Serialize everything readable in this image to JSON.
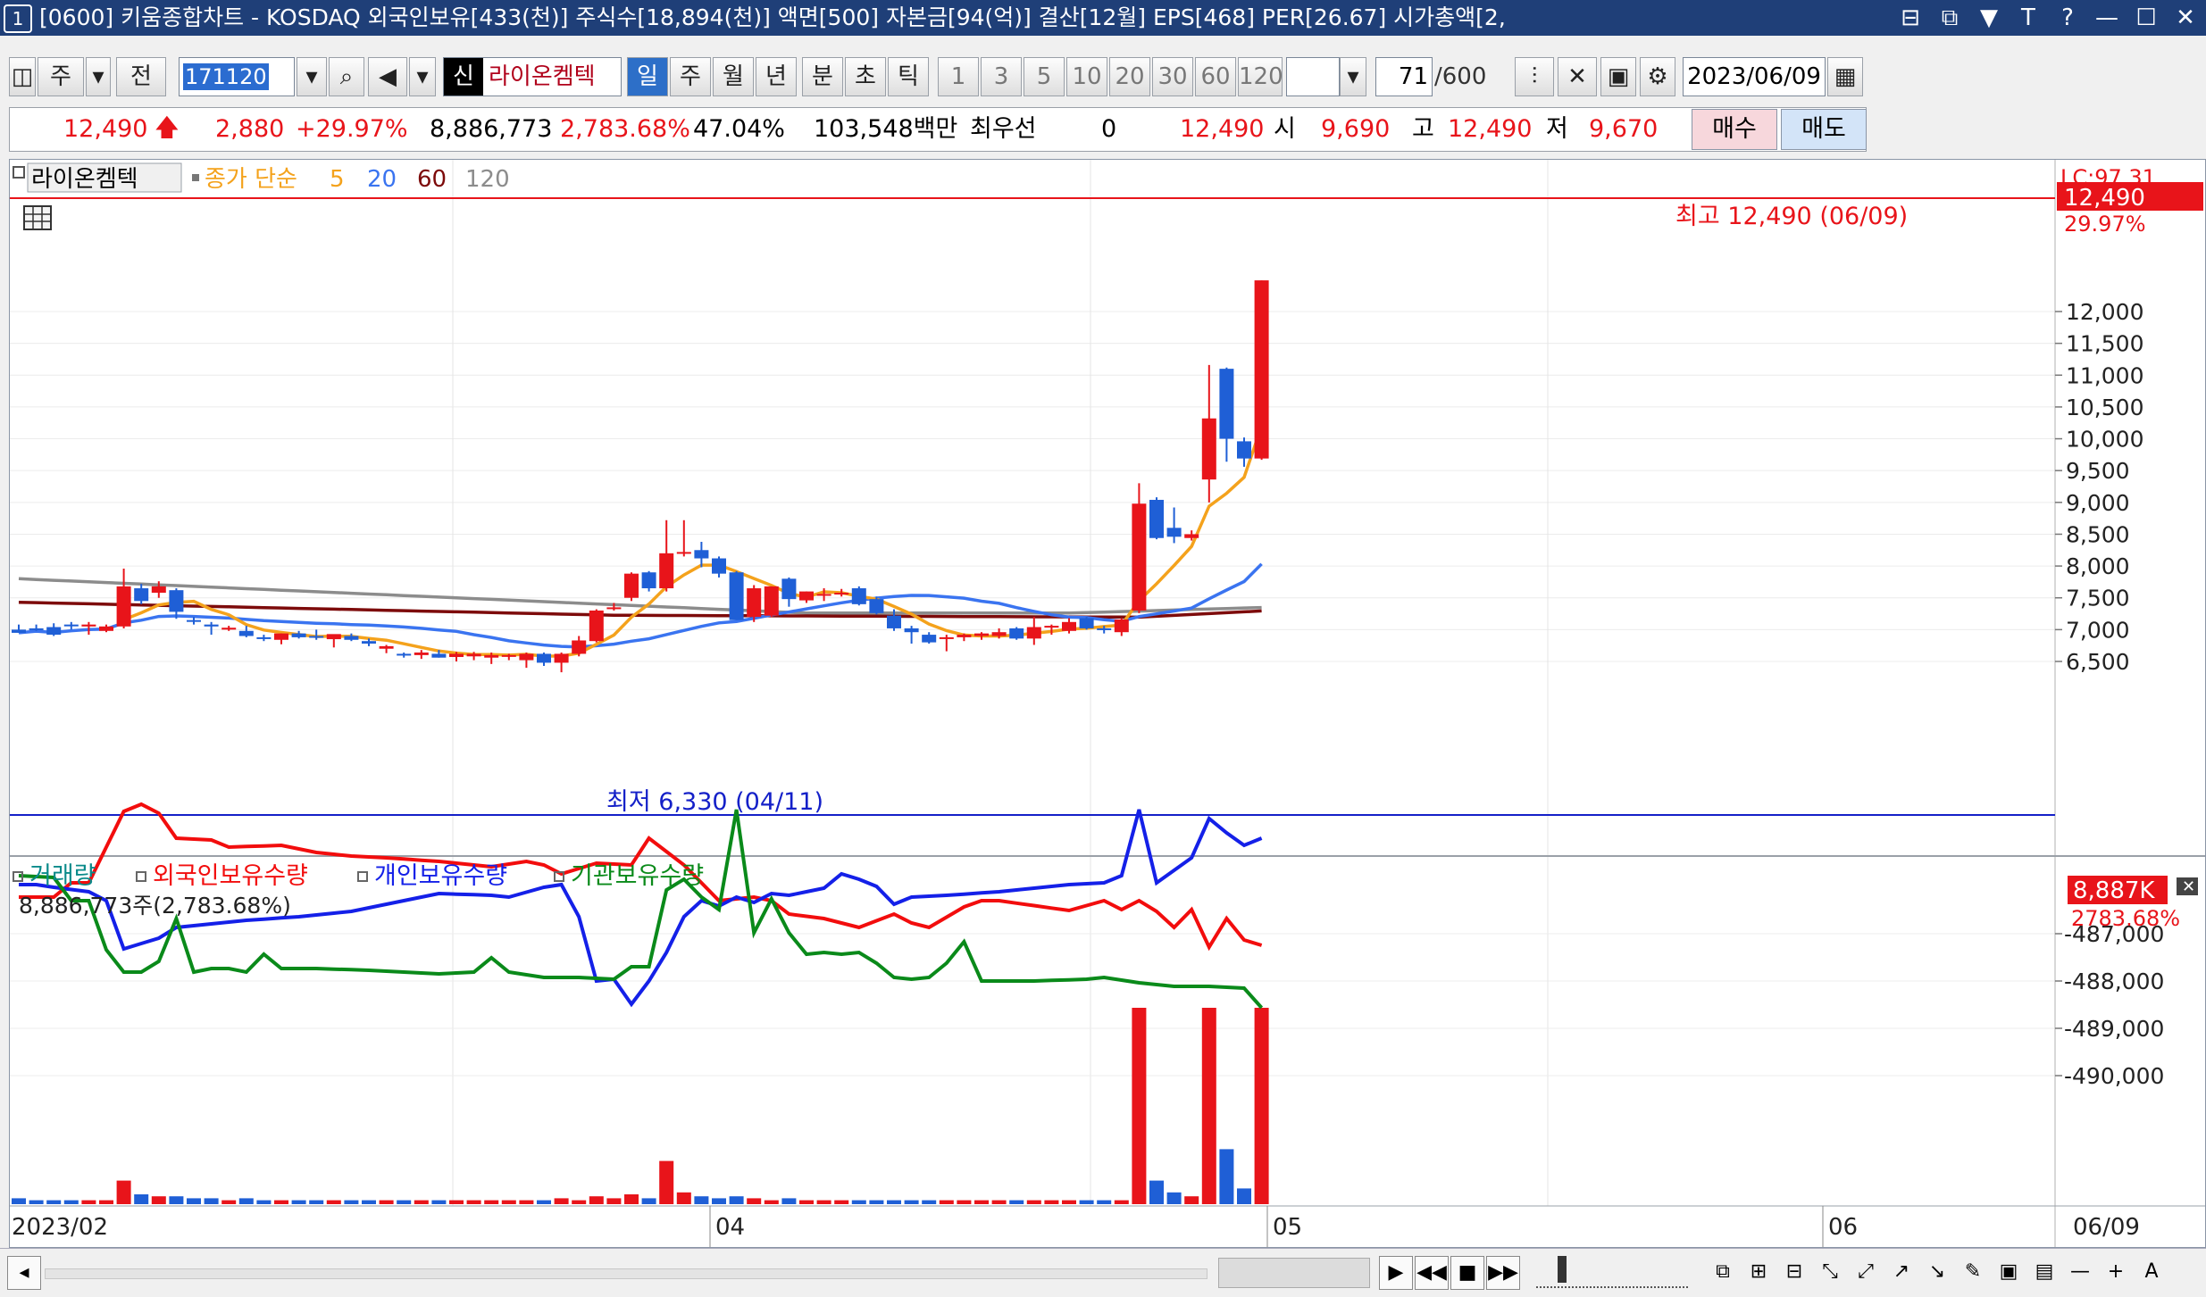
{
  "window": {
    "num": "1",
    "title": "[0600] 키움종합차트 - KOSDAQ 외국인보유[433(천)] 주식수[18,894(천)] 액면[500] 자본금[94(억)] 결산[12월] EPS[468] PER[26.67] 시가총액[2,",
    "controls": [
      "⊟",
      "⧉",
      "▼",
      "T",
      "?",
      "—",
      "☐",
      "✕"
    ]
  },
  "toolbar": {
    "market": "주",
    "mode": "전",
    "code": "171120",
    "shin": "신",
    "stock_name": "라이온켐텍",
    "periods": [
      "일",
      "주",
      "월",
      "년",
      "분",
      "초",
      "틱"
    ],
    "selected_period": "일",
    "intervals": [
      "1",
      "3",
      "5",
      "10",
      "20",
      "30",
      "60",
      "120"
    ],
    "count": "71",
    "count_total": "/600",
    "date": "2023/06/09"
  },
  "quote": {
    "price": "12,490",
    "change": "2,880",
    "change_pct": "+29.97%",
    "volume": "8,886,773",
    "volume_pct": "2,783.68%",
    "ratio": "47.04%",
    "amount": "103,548백만",
    "best_label": "최우선",
    "best_qty": "0",
    "best_price": "12,490",
    "open_label": "시",
    "open": "9,690",
    "high_label": "고",
    "high": "12,490",
    "low_label": "저",
    "low": "9,670",
    "buy": "매수",
    "sell": "매도"
  },
  "colors": {
    "up": "#e8141a",
    "down": "#1f5fd6",
    "ma5": "#f4a21c",
    "ma20": "#3a74f0",
    "ma60": "#7d0b0b",
    "ma120": "#8c8c8c",
    "foreign": "#f20d0d",
    "individual": "#1420e8",
    "institution": "#0a8a1a"
  },
  "legend": {
    "name": "라이온켐텍",
    "ma_label": "종가 단순",
    "ma": [
      "5",
      "20",
      "60",
      "120"
    ]
  },
  "annotations": {
    "high": "최고 12,490 (06/09)",
    "low": "최저 6,330 (04/11)",
    "price_tag": "12,490",
    "pct_tag": "29.97%",
    "lc_tag": "LC:97.31"
  },
  "price_axis": [
    "12,000",
    "11,500",
    "11,000",
    "10,500",
    "10,000",
    "9,500",
    "9,000",
    "8,500",
    "8,000",
    "7,500",
    "7,000",
    "6,500"
  ],
  "lower": {
    "legend": [
      "거래량",
      "외국인보유수량",
      "개인보유수량",
      "기관보유수량"
    ],
    "info": "8,886,773주(2,783.68%)",
    "tag": "8,887K",
    "tag_pct": "2783.68%",
    "axis": [
      "-487,000",
      "-488,000",
      "-489,000",
      "-490,000"
    ]
  },
  "time_axis": [
    "2023/02",
    "04",
    "05",
    "06",
    "06/09"
  ],
  "chart_data": {
    "type": "candlestick",
    "title": "라이온켐텍",
    "ylim": [
      6200,
      12600
    ],
    "candles": [
      {
        "o": 7000,
        "h": 7080,
        "l": 6950,
        "c": 6950
      },
      {
        "o": 7020,
        "h": 7080,
        "l": 6980,
        "c": 7000
      },
      {
        "o": 7040,
        "h": 7100,
        "l": 6900,
        "c": 6920
      },
      {
        "o": 7080,
        "h": 7120,
        "l": 7000,
        "c": 7060
      },
      {
        "o": 7050,
        "h": 7120,
        "l": 6920,
        "c": 7080
      },
      {
        "o": 6980,
        "h": 7080,
        "l": 6960,
        "c": 7050
      },
      {
        "o": 7050,
        "h": 7960,
        "l": 7020,
        "c": 7680
      },
      {
        "o": 7650,
        "h": 7720,
        "l": 7400,
        "c": 7450
      },
      {
        "o": 7580,
        "h": 7760,
        "l": 7500,
        "c": 7680
      },
      {
        "o": 7620,
        "h": 7650,
        "l": 7170,
        "c": 7280
      },
      {
        "o": 7150,
        "h": 7200,
        "l": 7080,
        "c": 7130
      },
      {
        "o": 7080,
        "h": 7120,
        "l": 6920,
        "c": 7050
      },
      {
        "o": 7000,
        "h": 7060,
        "l": 6980,
        "c": 7030
      },
      {
        "o": 6980,
        "h": 7060,
        "l": 6880,
        "c": 6900
      },
      {
        "o": 6880,
        "h": 6920,
        "l": 6820,
        "c": 6860
      },
      {
        "o": 6840,
        "h": 6940,
        "l": 6770,
        "c": 6940
      },
      {
        "o": 6940,
        "h": 6980,
        "l": 6860,
        "c": 6880
      },
      {
        "o": 6900,
        "h": 7000,
        "l": 6840,
        "c": 6880
      },
      {
        "o": 6850,
        "h": 6920,
        "l": 6720,
        "c": 6930
      },
      {
        "o": 6900,
        "h": 6940,
        "l": 6820,
        "c": 6840
      },
      {
        "o": 6820,
        "h": 6860,
        "l": 6740,
        "c": 6780
      },
      {
        "o": 6700,
        "h": 6760,
        "l": 6630,
        "c": 6740
      },
      {
        "o": 6620,
        "h": 6640,
        "l": 6560,
        "c": 6600
      },
      {
        "o": 6600,
        "h": 6680,
        "l": 6540,
        "c": 6640
      },
      {
        "o": 6620,
        "h": 6680,
        "l": 6560,
        "c": 6560
      },
      {
        "o": 6570,
        "h": 6650,
        "l": 6500,
        "c": 6620
      },
      {
        "o": 6580,
        "h": 6650,
        "l": 6520,
        "c": 6620
      },
      {
        "o": 6560,
        "h": 6640,
        "l": 6460,
        "c": 6600
      },
      {
        "o": 6580,
        "h": 6620,
        "l": 6520,
        "c": 6600
      },
      {
        "o": 6520,
        "h": 6640,
        "l": 6400,
        "c": 6620
      },
      {
        "o": 6620,
        "h": 6640,
        "l": 6430,
        "c": 6480
      },
      {
        "o": 6480,
        "h": 6640,
        "l": 6330,
        "c": 6620
      },
      {
        "o": 6620,
        "h": 6900,
        "l": 6580,
        "c": 6830
      },
      {
        "o": 6820,
        "h": 7320,
        "l": 6800,
        "c": 7300
      },
      {
        "o": 7340,
        "h": 7420,
        "l": 7300,
        "c": 7350
      },
      {
        "o": 7500,
        "h": 7900,
        "l": 7450,
        "c": 7880
      },
      {
        "o": 7900,
        "h": 7920,
        "l": 7600,
        "c": 7650
      },
      {
        "o": 7650,
        "h": 8720,
        "l": 7600,
        "c": 8200
      },
      {
        "o": 8200,
        "h": 8720,
        "l": 8150,
        "c": 8220
      },
      {
        "o": 8250,
        "h": 8380,
        "l": 7980,
        "c": 8120
      },
      {
        "o": 8120,
        "h": 8150,
        "l": 7820,
        "c": 7880
      },
      {
        "o": 7900,
        "h": 7920,
        "l": 7150,
        "c": 7150
      },
      {
        "o": 7200,
        "h": 7700,
        "l": 7120,
        "c": 7650
      },
      {
        "o": 7220,
        "h": 7680,
        "l": 7200,
        "c": 7680
      },
      {
        "o": 7800,
        "h": 7820,
        "l": 7360,
        "c": 7480
      },
      {
        "o": 7460,
        "h": 7600,
        "l": 7420,
        "c": 7600
      },
      {
        "o": 7540,
        "h": 7650,
        "l": 7450,
        "c": 7560
      },
      {
        "o": 7560,
        "h": 7640,
        "l": 7520,
        "c": 7580
      },
      {
        "o": 7650,
        "h": 7680,
        "l": 7380,
        "c": 7400
      },
      {
        "o": 7480,
        "h": 7520,
        "l": 7240,
        "c": 7260
      },
      {
        "o": 7220,
        "h": 7320,
        "l": 6980,
        "c": 7020
      },
      {
        "o": 7020,
        "h": 7060,
        "l": 6780,
        "c": 6960
      },
      {
        "o": 6920,
        "h": 6960,
        "l": 6780,
        "c": 6800
      },
      {
        "o": 6860,
        "h": 6920,
        "l": 6660,
        "c": 6880
      },
      {
        "o": 6880,
        "h": 6940,
        "l": 6820,
        "c": 6920
      },
      {
        "o": 6900,
        "h": 6960,
        "l": 6840,
        "c": 6940
      },
      {
        "o": 6900,
        "h": 7020,
        "l": 6860,
        "c": 6960
      },
      {
        "o": 7020,
        "h": 7040,
        "l": 6840,
        "c": 6860
      },
      {
        "o": 6860,
        "h": 7200,
        "l": 6760,
        "c": 7040
      },
      {
        "o": 7040,
        "h": 7080,
        "l": 6920,
        "c": 7060
      },
      {
        "o": 6980,
        "h": 7180,
        "l": 6940,
        "c": 7120
      },
      {
        "o": 7180,
        "h": 7200,
        "l": 7000,
        "c": 7020
      },
      {
        "o": 7020,
        "h": 7060,
        "l": 6940,
        "c": 7000
      },
      {
        "o": 6960,
        "h": 7180,
        "l": 6900,
        "c": 7160
      },
      {
        "o": 7300,
        "h": 9300,
        "l": 7260,
        "c": 8980
      },
      {
        "o": 9040,
        "h": 9080,
        "l": 8420,
        "c": 8440
      },
      {
        "o": 8600,
        "h": 8920,
        "l": 8360,
        "c": 8460
      },
      {
        "o": 8440,
        "h": 8560,
        "l": 8400,
        "c": 8500
      },
      {
        "o": 9360,
        "h": 11160,
        "l": 9000,
        "c": 10320
      },
      {
        "o": 11100,
        "h": 11120,
        "l": 9640,
        "c": 10000
      },
      {
        "o": 9960,
        "h": 10020,
        "l": 9560,
        "c": 9690
      },
      {
        "o": 9690,
        "h": 12490,
        "l": 9670,
        "c": 12490
      }
    ],
    "volume": [
      0.03,
      0.02,
      0.02,
      0.02,
      0.02,
      0.02,
      0.12,
      0.05,
      0.04,
      0.04,
      0.03,
      0.03,
      0.02,
      0.03,
      0.02,
      0.02,
      0.02,
      0.02,
      0.02,
      0.02,
      0.02,
      0.02,
      0.02,
      0.02,
      0.02,
      0.02,
      0.02,
      0.02,
      0.02,
      0.02,
      0.02,
      0.03,
      0.02,
      0.04,
      0.03,
      0.05,
      0.03,
      0.22,
      0.06,
      0.04,
      0.03,
      0.04,
      0.03,
      0.02,
      0.03,
      0.02,
      0.02,
      0.02,
      0.02,
      0.02,
      0.02,
      0.02,
      0.02,
      0.02,
      0.02,
      0.02,
      0.02,
      0.02,
      0.02,
      0.02,
      0.02,
      0.02,
      0.02,
      0.02,
      1.0,
      0.12,
      0.06,
      0.04,
      1.0,
      0.28,
      0.08,
      1.0
    ]
  }
}
